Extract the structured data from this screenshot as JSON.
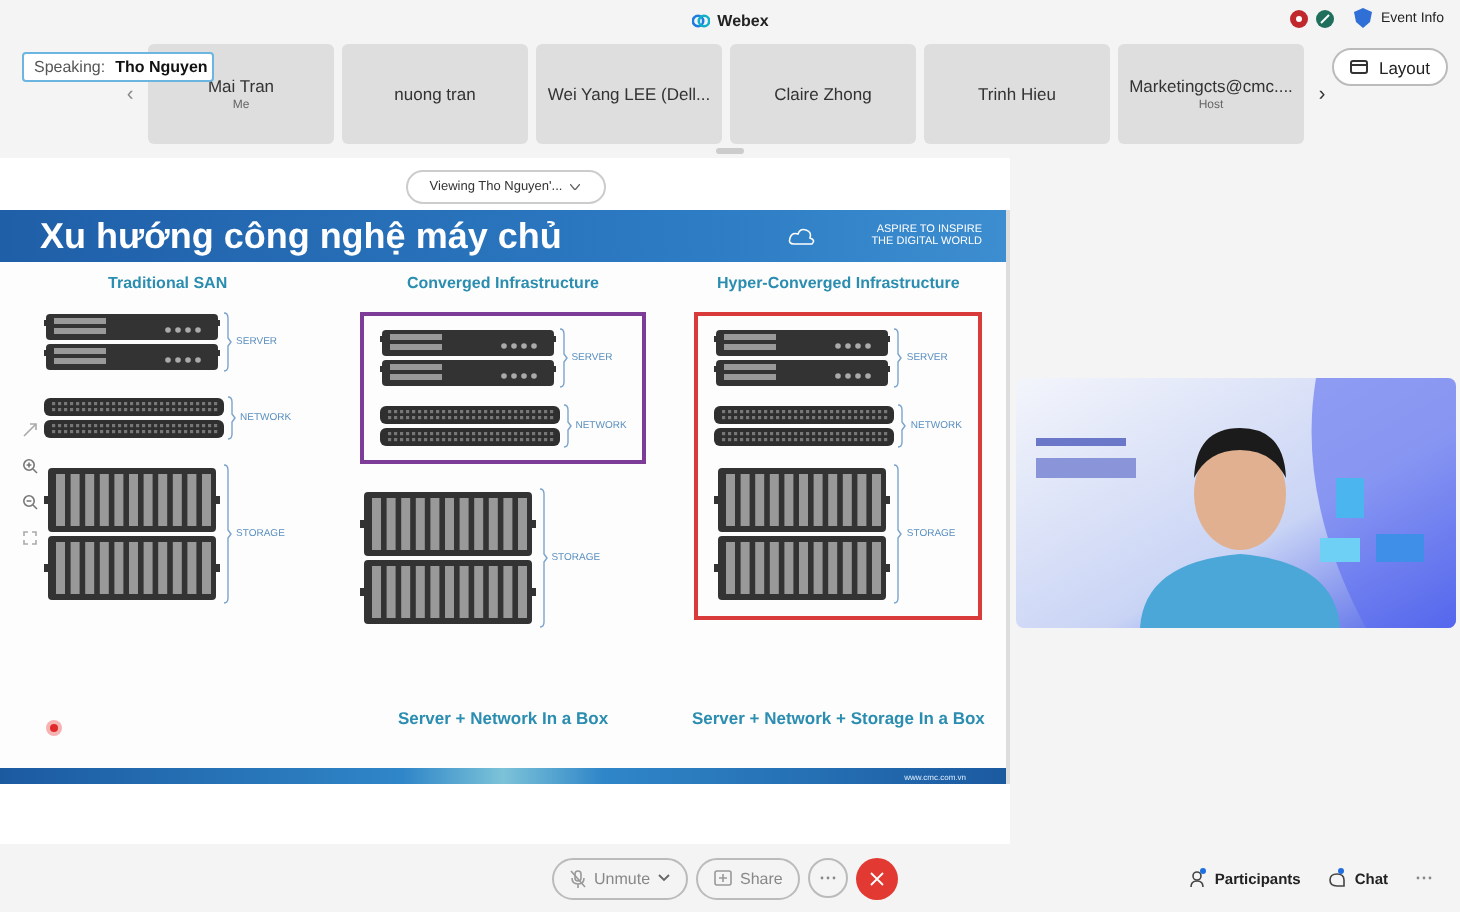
{
  "top_bar": {
    "title": "Webex",
    "event_info": "Event Info"
  },
  "speaking": {
    "label": "Speaking:",
    "name": "Tho Nguyen"
  },
  "scroll_left": "‹",
  "participants": [
    {
      "name": "Mai Tran",
      "role": "Me"
    },
    {
      "name": "nuong tran"
    },
    {
      "name": "Wei Yang LEE (Dell..."
    },
    {
      "name": "Claire Zhong"
    },
    {
      "name": "Trinh Hieu"
    },
    {
      "name": "Marketingcts@cmc....",
      "role": "Host"
    }
  ],
  "scroll_right": "›",
  "layout_button": "Layout",
  "viewing": "Viewing Tho Nguyen'...",
  "slide": {
    "title": "Xu hướng công nghệ máy chủ",
    "tagline": [
      "ASPIRE TO INSPIRE",
      "THE DIGITAL WORLD"
    ],
    "footer": "www.cmc.com.vn",
    "columns": [
      {
        "heading": "Traditional SAN",
        "components": [
          {
            "kind": "server",
            "label": "SERVER"
          },
          {
            "kind": "network",
            "label": "NETWORK"
          },
          {
            "kind": "storage",
            "label": "STORAGE"
          }
        ]
      },
      {
        "heading": "Converged Infrastructure",
        "frame": {
          "color": "#7d3c98",
          "components": [
            {
              "kind": "server",
              "label": "SERVER"
            },
            {
              "kind": "network",
              "label": "NETWORK"
            }
          ]
        },
        "components": [
          {
            "kind": "storage",
            "label": "STORAGE"
          }
        ],
        "caption": "Server + Network In a Box"
      },
      {
        "heading": "Hyper-Converged Infrastructure",
        "frame": {
          "color": "#d93a3a",
          "components": [
            {
              "kind": "server",
              "label": "SERVER"
            },
            {
              "kind": "network",
              "label": "NETWORK"
            },
            {
              "kind": "storage",
              "label": "STORAGE"
            }
          ]
        },
        "caption": "Server + Network + Storage In a Box"
      }
    ]
  },
  "controls": {
    "unmute": "Unmute",
    "share": "Share",
    "participants": "Participants",
    "chat": "Chat"
  }
}
